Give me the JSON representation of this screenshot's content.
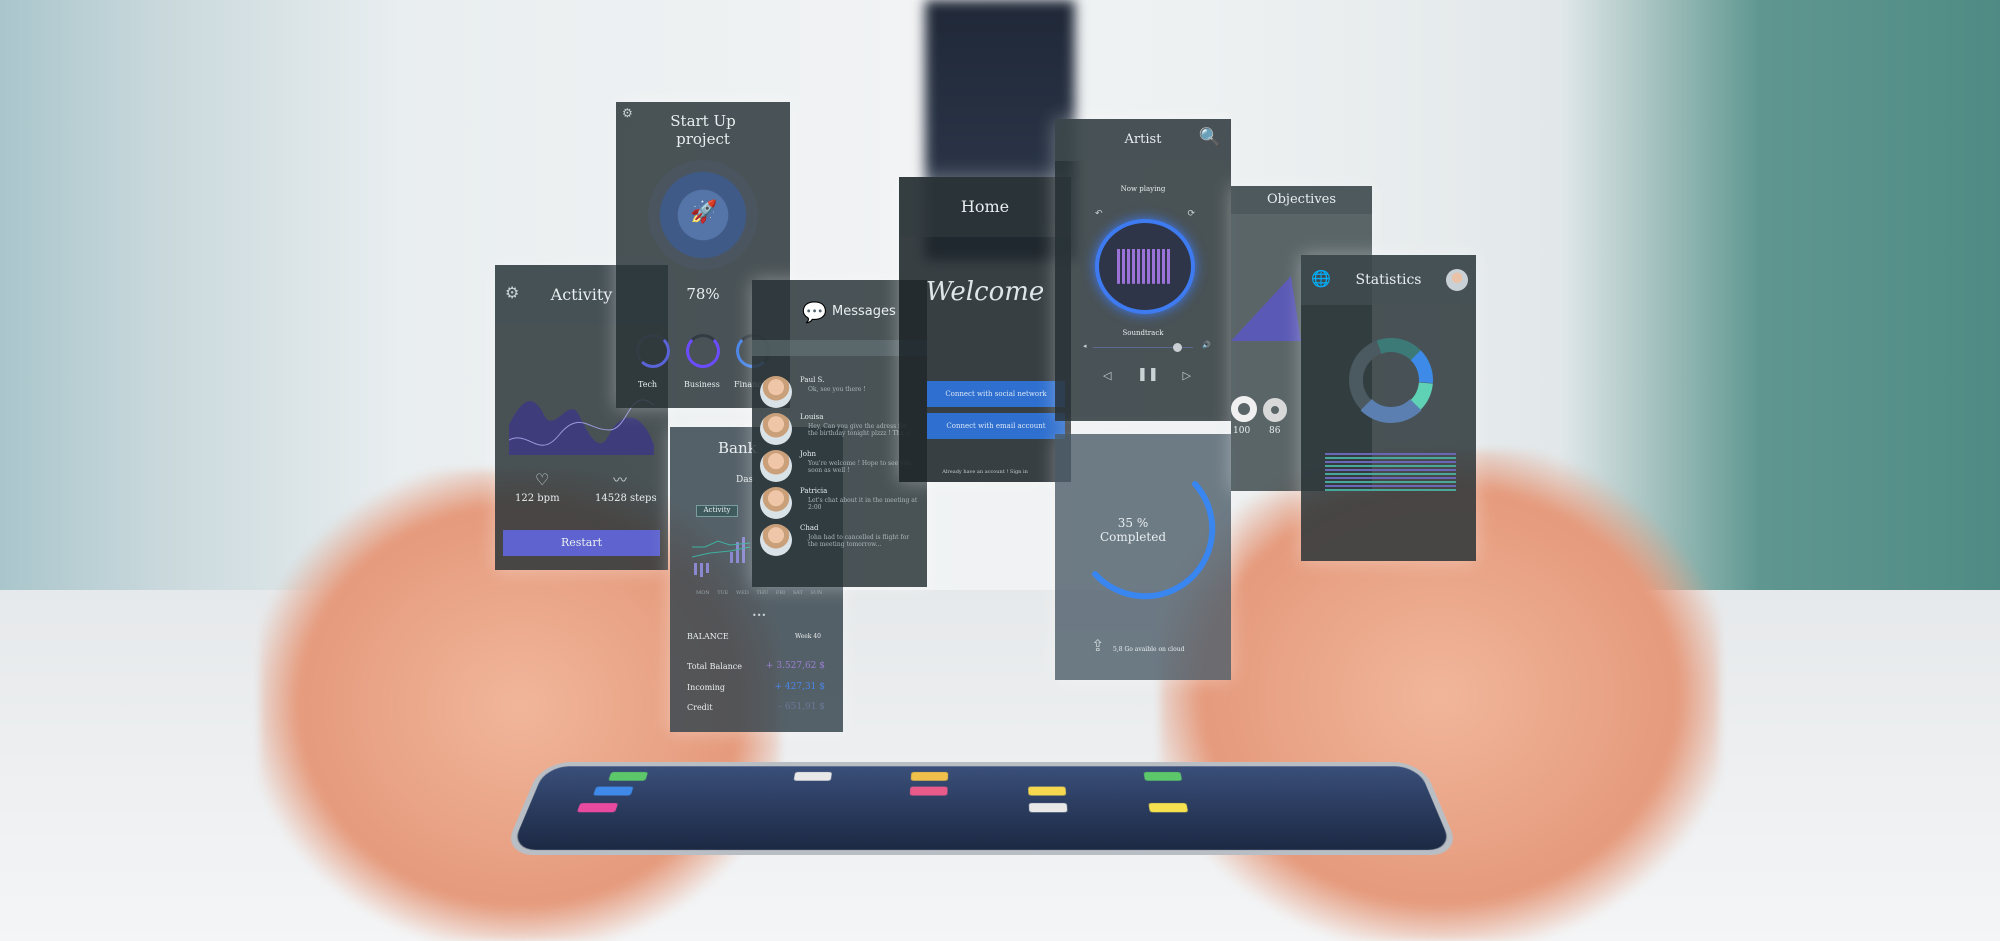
{
  "activity": {
    "title": "Activity",
    "bpm": "122 bpm",
    "steps": "14528 steps",
    "button": "Restart"
  },
  "startup": {
    "title_line1": "Start Up",
    "title_line2": "project",
    "percent": "78%",
    "progress": 78,
    "categories": [
      {
        "label": "Tech"
      },
      {
        "label": "Business"
      },
      {
        "label": "Finance"
      }
    ]
  },
  "bank": {
    "title": "Bank",
    "subtitle": "Das",
    "tab": "Activity",
    "chart_days": [
      "MON",
      "TUE",
      "WED",
      "THU",
      "FRI",
      "SAT",
      "SUN"
    ],
    "balance_label": "BALANCE",
    "week": "Week 40",
    "rows": [
      {
        "label": "Total Balance",
        "value": "+ 3.527,62 $",
        "color": "#9b7fd4"
      },
      {
        "label": "Incoming",
        "value": "+ 427,31 $",
        "color": "#4a86e8"
      },
      {
        "label": "Credit",
        "value": "- 651,91 $",
        "color": "#6b7a9a"
      }
    ]
  },
  "messages": {
    "title": "Messages",
    "items": [
      {
        "name": "Paul S.",
        "text": "Ok, see you there !"
      },
      {
        "name": "Louisa",
        "text": "Hey, Can you give the adress for the birthday tonight plzzz ! Thx :)"
      },
      {
        "name": "John",
        "text": "You're welcome ! Hope to see you soon as well !"
      },
      {
        "name": "Patricia",
        "text": "Let's chat about it in the meeting at 2:00"
      },
      {
        "name": "Chad",
        "text": "John had to cancelled is flight for the meeting tomorrow..."
      }
    ]
  },
  "home": {
    "title": "Home",
    "welcome": "Welcome",
    "social_button": "Connect with social network",
    "email_button": "Connect with email account",
    "signin": "Already have an account ! Sign in"
  },
  "artist": {
    "title": "Artist",
    "now_playing": "Now playing",
    "track": "Soundtrack",
    "volume": 0.8
  },
  "completed": {
    "percent_text": "35 %",
    "label": "Completed",
    "progress": 35,
    "cloud_text": "5,8 Go avaible on cloud"
  },
  "objectives": {
    "title": "Objectives",
    "values": [
      "100",
      "86"
    ]
  },
  "statistics": {
    "title": "Statistics"
  },
  "colors": {
    "accent_blue": "#2e6fcf",
    "purple": "#6a5fd8",
    "teal": "#5fd1b5"
  }
}
